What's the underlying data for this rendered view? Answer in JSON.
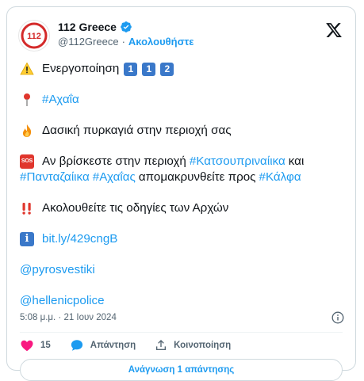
{
  "account": {
    "name": "112 Greece",
    "handle": "@112Greece",
    "separator": "·",
    "follow_label": "Ακολουθήστε",
    "avatar_text": "112",
    "verified_icon": "verified-badge-icon"
  },
  "tweet": {
    "line1_text": "Ενεργοποίηση",
    "line1_keys": [
      "1",
      "1",
      "2"
    ],
    "line2_hashtag": "#Αχαΐα",
    "line3_text": "Δασική πυρκαγιά στην περιοχή σας",
    "line4_sos": "SOS",
    "line4_text_a": "Αν βρίσκεστε στην περιοχή",
    "line4_hashtag_a": "#Κατσουπριναίικα",
    "line4_text_b": "και",
    "line4_hashtag_b": "#Πανταζαίικα",
    "line4_hashtag_c": "#Αχαΐας",
    "line4_text_c": "απομακρυνθείτε προς",
    "line4_hashtag_d": "#Κάλφα",
    "line5_text": "Ακολουθείτε τις οδηγίες των Αρχών",
    "line6_info": "i",
    "line6_link": "bit.ly/429cngB",
    "mention_1": "@pyrosvestiki",
    "mention_2": "@hellenicpolice"
  },
  "meta": {
    "timestamp": "5:08 μ.μ. · 21 Ιουν 2024"
  },
  "actions": {
    "likes_count": "15",
    "reply_label": "Απάντηση",
    "share_label": "Κοινοποίηση",
    "read_replies_label": "Ανάγνωση 1 απάντησης"
  },
  "colors": {
    "accent": "#1d9bf0",
    "like": "#f91880",
    "sos": "#e0362d",
    "keycap": "#3a78c9"
  }
}
